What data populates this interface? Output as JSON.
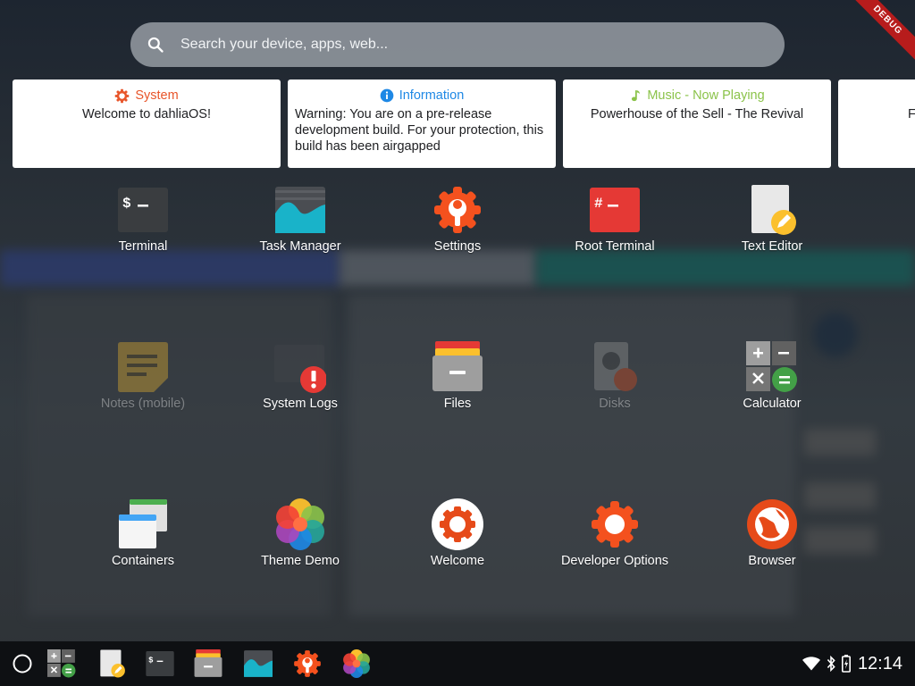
{
  "search": {
    "placeholder": "Search your device, apps, web..."
  },
  "debug_banner": "DEBUG",
  "notifications": [
    {
      "title": "System",
      "body": "Welcome to dahliaOS!",
      "color": "#e8552a",
      "icon": "gear-icon"
    },
    {
      "title": "Information",
      "body": "Warning: You are on a pre-release development build. For your protection, this build has been airgapped",
      "color": "#1e88e5",
      "icon": "info-icon"
    },
    {
      "title": "Music - Now Playing",
      "body": "Powerhouse of the Sell - The Revival",
      "color": "#8bc34a",
      "icon": "music-note-icon"
    },
    {
      "title": "",
      "body": "F",
      "color": "#333333",
      "icon": ""
    }
  ],
  "apps": [
    {
      "label": "Terminal",
      "icon": "terminal-icon"
    },
    {
      "label": "Task Manager",
      "icon": "task-manager-icon"
    },
    {
      "label": "Settings",
      "icon": "settings-icon"
    },
    {
      "label": "Root Terminal",
      "icon": "root-terminal-icon"
    },
    {
      "label": "Text Editor",
      "icon": "text-editor-icon"
    },
    {
      "label": "Notes (mobile)",
      "icon": "notes-icon"
    },
    {
      "label": "System Logs",
      "icon": "system-logs-icon"
    },
    {
      "label": "Files",
      "icon": "files-icon"
    },
    {
      "label": "Disks",
      "icon": "disks-icon"
    },
    {
      "label": "Calculator",
      "icon": "calculator-icon"
    },
    {
      "label": "Containers",
      "icon": "containers-icon"
    },
    {
      "label": "Theme Demo",
      "icon": "theme-demo-icon"
    },
    {
      "label": "Welcome",
      "icon": "welcome-icon"
    },
    {
      "label": "Developer Options",
      "icon": "developer-options-icon"
    },
    {
      "label": "Browser",
      "icon": "browser-icon"
    }
  ],
  "taskbar": {
    "launcher": "launcher-icon",
    "pinned": [
      "calculator-icon",
      "text-editor-icon",
      "terminal-icon",
      "files-icon",
      "task-manager-icon",
      "settings-icon",
      "theme-demo-icon"
    ],
    "clock": "12:14",
    "status_icons": [
      "wifi-icon",
      "bluetooth-icon",
      "battery-icon"
    ]
  },
  "colors": {
    "accent": "#ff5722",
    "card_bg": "#ffffff",
    "taskbar_bg": "#0e1013"
  }
}
